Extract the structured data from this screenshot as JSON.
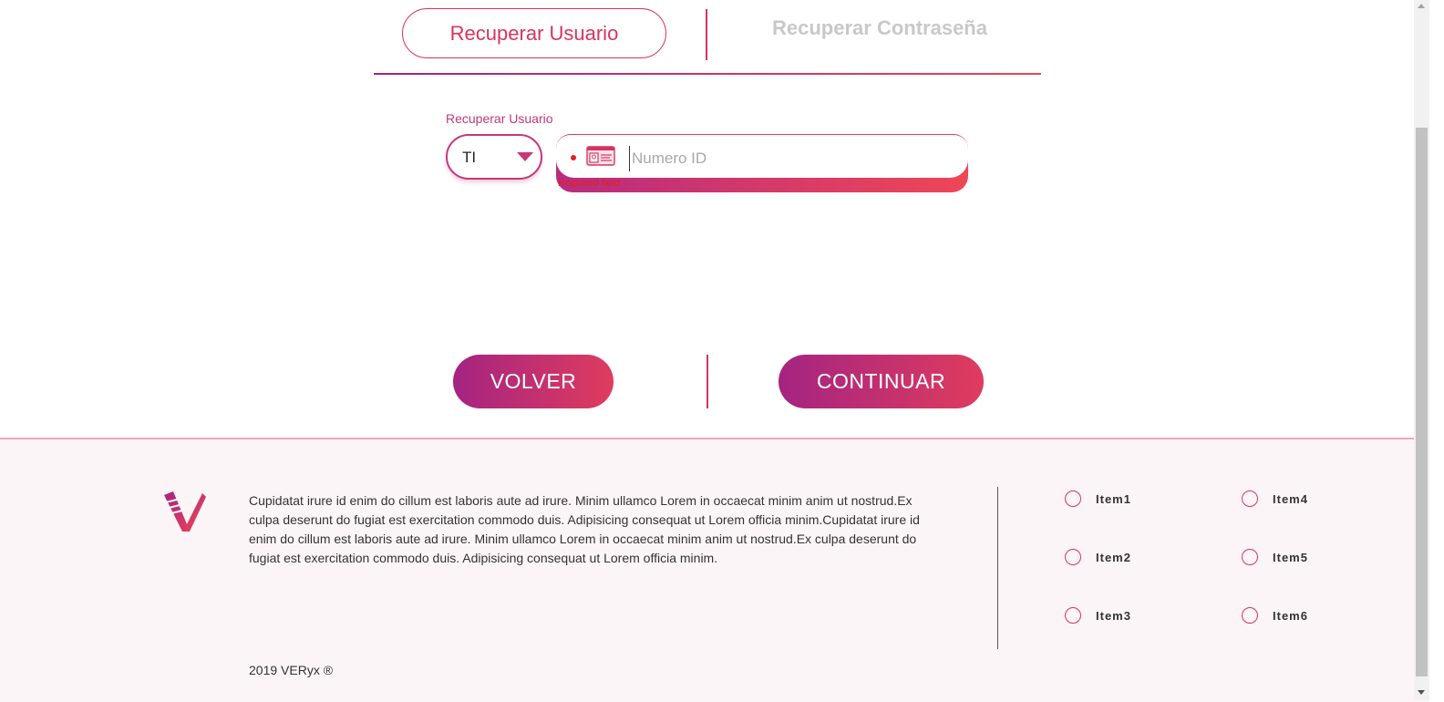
{
  "tabs": {
    "active": "Recuperar Usuario",
    "inactive": "Recuperar Contraseña"
  },
  "form": {
    "label": "Recuperar Usuario",
    "doc_type_value": "TI",
    "id_placeholder": "Numero ID",
    "id_value": "",
    "error": "Required field"
  },
  "buttons": {
    "back": "VOLVER",
    "continue": "CONTINUAR"
  },
  "footer": {
    "text": "Cupidatat irure id enim do cillum est laboris aute ad irure. Minim ullamco Lorem in occaecat minim anim ut nostrud.Ex culpa deserunt do fugiat est exercitation commodo duis. Adipisicing consequat ut Lorem officia minim.Cupidatat irure id enim do cillum est laboris aute ad irure. Minim ullamco Lorem in occaecat minim anim ut nostrud.Ex culpa deserunt do fugiat est exercitation commodo duis. Adipisicing consequat ut Lorem officia minim.",
    "items": [
      "Item1",
      "Item2",
      "Item3",
      "Item4",
      "Item5",
      "Item6"
    ],
    "copyright": "2019 VERyx ®"
  },
  "colors": {
    "accent": "#d8335d",
    "gradient_start": "#a42481",
    "gradient_end": "#df3c5e",
    "error": "#e02020"
  },
  "icons": {
    "doc_select": "chevron-down-icon",
    "id_field": "id-card-icon",
    "logo": "veryx-logo"
  }
}
